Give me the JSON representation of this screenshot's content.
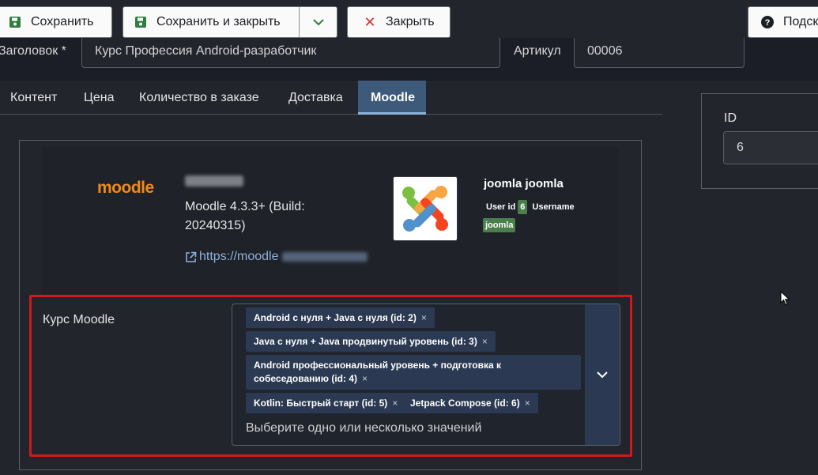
{
  "toolbar": {
    "save_label": "Сохранить",
    "save_close_label": "Сохранить и закрыть",
    "close_label": "Закрыть",
    "help_label": "Подсказка"
  },
  "form": {
    "title_label": "Заголовок *",
    "title_value": "Курс Профессия Android-разработчик",
    "article_label": "Артикул",
    "article_value": "00006"
  },
  "tabs": [
    {
      "label": "Контент"
    },
    {
      "label": "Цена"
    },
    {
      "label": "Количество в заказе"
    },
    {
      "label": "Доставка"
    },
    {
      "label": "Moodle",
      "active": true
    }
  ],
  "id_panel": {
    "label": "ID",
    "value": "6"
  },
  "moodle_info": {
    "logo_text": "moodle",
    "version": "Moodle 4.3.3+ (Build: 20240315)",
    "url_prefix": "https://moodle"
  },
  "joomla_user": {
    "name": "joomla joomla",
    "user_id_label": "User id",
    "user_id": "6",
    "username_label": "Username",
    "username": "joomla"
  },
  "course_field": {
    "label": "Курс Moodle",
    "placeholder": "Выберите одно или несколько значений",
    "selected": [
      {
        "text": "Android с нуля + Java с нуля (id: 2)"
      },
      {
        "text": "Java с нуля + Java продвинутый уровень (id: 3)"
      },
      {
        "text": "Android профессиональный уровень + подготовка к собеседованию (id: 4)"
      },
      {
        "text": "Kotlin: Быстрый старт (id: 5)"
      },
      {
        "text": "Jetpack Compose (id: 6)"
      }
    ],
    "remove_symbol": "×"
  },
  "colors": {
    "accent_tab": "#3d5a7b",
    "chip_bg": "#2b3a52",
    "badge_green": "#4a7f4c",
    "highlight_red": "#d0191a",
    "moodle_orange": "#f08a1c",
    "link_blue": "#8db1db"
  }
}
